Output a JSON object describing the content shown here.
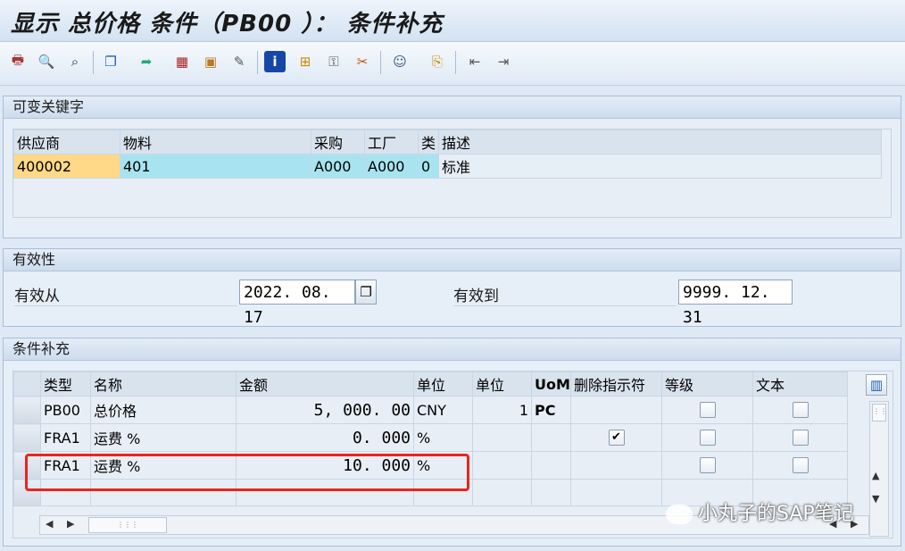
{
  "window": {
    "title": "显示 总价格 条件（PB00 ）： 条件补充"
  },
  "toolbar": {
    "icons": [
      "print-icon",
      "find-icon",
      "find-next-icon",
      "copy-icon",
      "export-icon",
      "calendar-icon",
      "gift-icon",
      "edit-icon",
      "info-icon",
      "structure-icon",
      "key-icon",
      "scale-icon",
      "user-icon",
      "cut-icon",
      "first-page-icon",
      "last-page-icon"
    ]
  },
  "keys_group": {
    "title": "可变关键字",
    "headers": [
      "供应商",
      "物料",
      "采购",
      "工厂",
      "类",
      "描述"
    ],
    "row": {
      "vendor": "400002",
      "material": "401",
      "purch_org": "A000",
      "plant": "A000",
      "type": "0",
      "desc": "标准"
    }
  },
  "validity_group": {
    "title": "有效性",
    "from_label": "有效从",
    "from_value": "2022. 08. 17",
    "to_label": "有效到",
    "to_value": "9999. 12. 31"
  },
  "supplement_group": {
    "title": "条件补充",
    "headers": [
      "类型",
      "名称",
      "金额",
      "单位",
      "单位",
      "UoM",
      "删除指示符",
      "等级",
      "文本"
    ],
    "rows": [
      {
        "type": "PB00",
        "name": "总价格",
        "amount": "5, 000. 00",
        "unit": "CNY",
        "per": "1",
        "uom": "PC",
        "deleted": false
      },
      {
        "type": "FRA1",
        "name": "运费 %",
        "amount": "0. 000",
        "unit": "%",
        "per": "",
        "uom": "",
        "deleted": true
      },
      {
        "type": "FRA1",
        "name": "运费 %",
        "amount": "10. 000",
        "unit": "%",
        "per": "",
        "uom": "",
        "deleted": false
      }
    ]
  },
  "watermark": "小丸子的SAP笔记",
  "colors": {
    "vendor_bg": "#ffd987",
    "material_bg": "#a8e4f0",
    "highlight": "#e8261c"
  }
}
